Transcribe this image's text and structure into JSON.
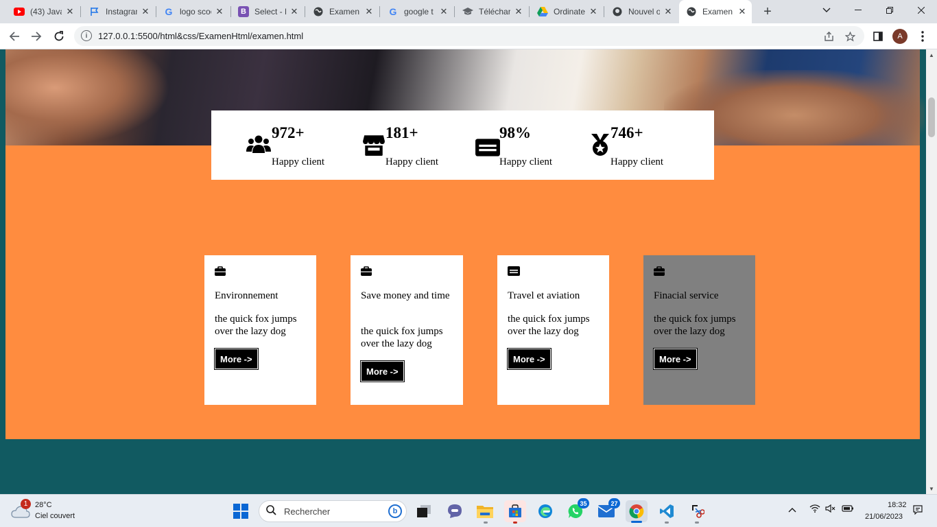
{
  "browser": {
    "tabs": [
      {
        "title": "(43) Java",
        "icon": "youtube-icon",
        "color": "#ff0000"
      },
      {
        "title": "Instagram",
        "icon": "flag-icon",
        "color": "#1a73e8"
      },
      {
        "title": "logo scool",
        "icon": "google-icon",
        "color": "#4285f4"
      },
      {
        "title": "Select - E",
        "icon": "bootstrap-icon",
        "color": "#7952b3"
      },
      {
        "title": "Examen",
        "icon": "globe-icon",
        "color": "#3c4043"
      },
      {
        "title": "google t",
        "icon": "google-icon",
        "color": "#4285f4"
      },
      {
        "title": "Téléchar",
        "icon": "graduation-cap-icon",
        "color": "#3c4043"
      },
      {
        "title": "Ordinate",
        "icon": "google-drive-icon",
        "color": "#0f9d58"
      },
      {
        "title": "Nouvel o",
        "icon": "github-icon",
        "color": "#3c4043"
      },
      {
        "title": "Examen",
        "icon": "globe-icon",
        "color": "#3c4043",
        "active": true
      }
    ],
    "url": "127.0.0.1:5500/html&css/ExamenHtml/examen.html",
    "profile_initial": "A"
  },
  "page": {
    "stats": [
      {
        "value": "972+",
        "label": "Happy client",
        "icon": "users-icon"
      },
      {
        "value": "181+",
        "label": "Happy client",
        "icon": "store-icon"
      },
      {
        "value": "98%",
        "label": "Happy client",
        "icon": "id-card-icon"
      },
      {
        "value": "746+",
        "label": "Happy client",
        "icon": "medal-icon"
      }
    ],
    "cards": [
      {
        "title": "Environnement",
        "text": "the quick fox jumps over the lazy dog",
        "button": "More ->",
        "icon": "briefcase-icon"
      },
      {
        "title": "Save money and time",
        "text": "the quick fox jumps over the lazy dog",
        "button": "More ->",
        "icon": "briefcase-icon"
      },
      {
        "title": "Travel et aviation",
        "text": "the quick fox jumps over the lazy dog",
        "button": "More ->",
        "icon": "id-card-icon"
      },
      {
        "title": "Finacial service",
        "text": "the quick fox jumps over the lazy dog",
        "button": "More ->",
        "icon": "briefcase-icon"
      }
    ],
    "colors": {
      "orange": "#ff8c3f",
      "teal": "#115a61",
      "card_grey": "#808080"
    }
  },
  "taskbar": {
    "weather": {
      "badge": "1",
      "temp": "28°C",
      "desc": "Ciel couvert"
    },
    "search_placeholder": "Rechercher",
    "badges": {
      "whatsapp": "35",
      "mail": "27"
    },
    "clock": {
      "time": "18:32",
      "date": "21/06/2023"
    }
  }
}
